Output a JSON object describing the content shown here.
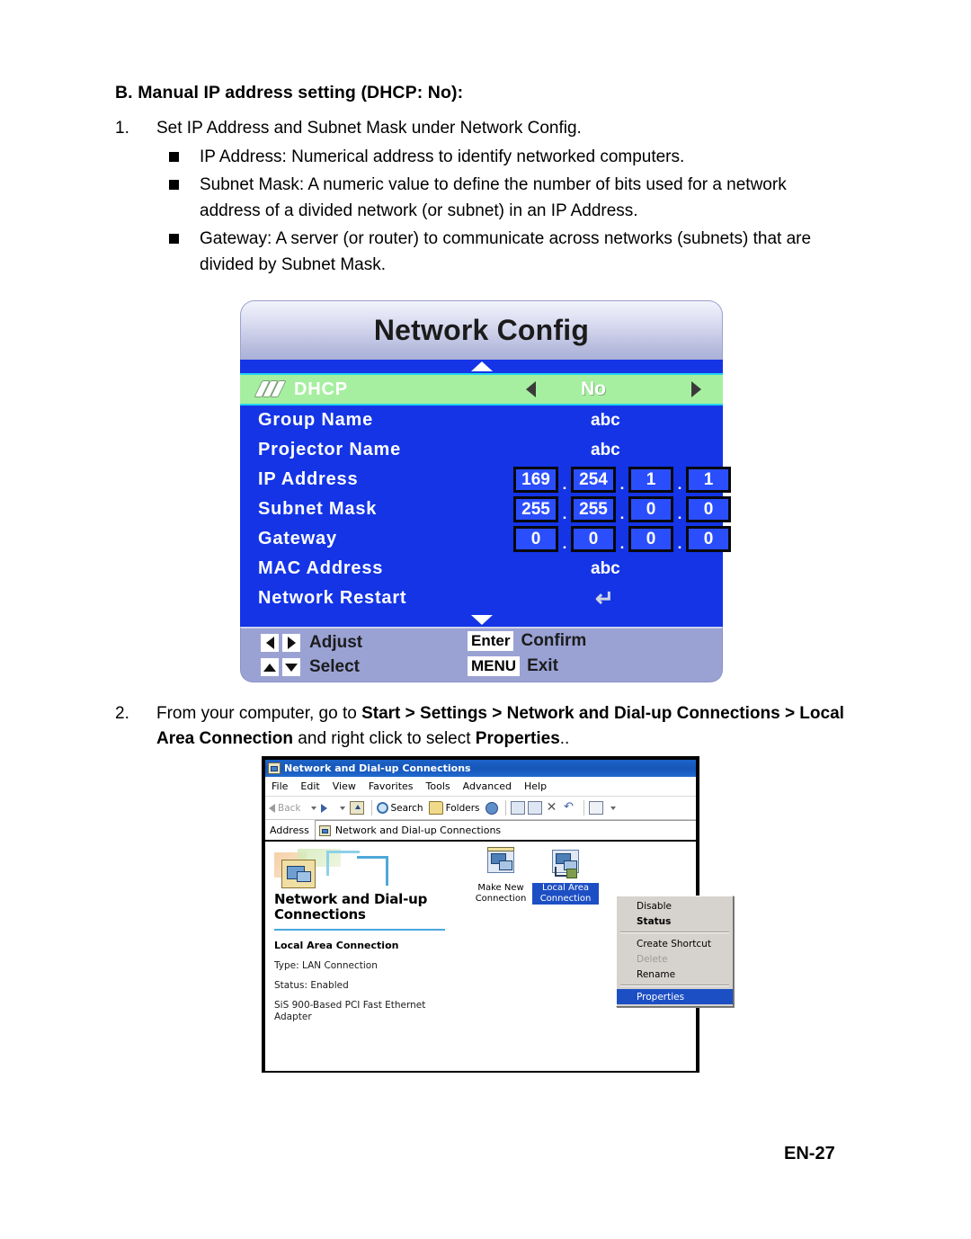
{
  "document": {
    "heading": "B. Manual IP address setting (DHCP: No):",
    "page_number": "EN-27",
    "step1": {
      "number": "1.",
      "text": "Set IP Address and Subnet Mask under Network Config.",
      "bullets": [
        "IP Address: Numerical address to identify networked computers.",
        "Subnet Mask: A numeric value to define the number of bits used for a network address of a divided network (or subnet) in an IP Address.",
        "Gateway: A server (or router) to communicate across networks (subnets) that are divided by Subnet Mask."
      ]
    },
    "step2": {
      "number": "2.",
      "part1": "From your computer, go to ",
      "bold1": "Start > Settings > Network and Dial-up Connections > Local Area Connection",
      "part2": " and right click to select ",
      "bold2": "Properties",
      "part3": ".."
    }
  },
  "osd": {
    "title": "Network Config",
    "scroll_up_icon": "triangle-up-icon",
    "scroll_down_icon": "triangle-down-icon",
    "rows": {
      "dhcp": {
        "label": "DHCP",
        "value": "No",
        "icon": "dhcp-chevrons-icon",
        "left_arrow": "left-arrow-icon",
        "right_arrow": "right-arrow-icon"
      },
      "group_name": {
        "label": "Group Name",
        "value": "abc"
      },
      "projector_name": {
        "label": "Projector Name",
        "value": "abc"
      },
      "ip_address": {
        "label": "IP Address",
        "octets": [
          "169",
          "254",
          "1",
          "1"
        ]
      },
      "subnet_mask": {
        "label": "Subnet Mask",
        "octets": [
          "255",
          "255",
          "0",
          "0"
        ]
      },
      "gateway": {
        "label": "Gateway",
        "octets": [
          "0",
          "0",
          "0",
          "0"
        ]
      },
      "mac_address": {
        "label": "MAC Address",
        "value": "abc"
      },
      "network_restart": {
        "label": "Network Restart",
        "value": "↵"
      }
    },
    "footer": {
      "adjust": "Adjust",
      "select": "Select",
      "enter_key": "Enter",
      "confirm": "Confirm",
      "menu_key": "MENU",
      "exit": "Exit"
    },
    "colors": {
      "body_blue": "#1434e6",
      "highlight_green": "#a6efa0",
      "highlight_border": "#23d3f0",
      "footer_lavender": "#9aa2d4"
    }
  },
  "explorer": {
    "title": "Network and Dial-up Connections",
    "title_icon": "network-connections-icon",
    "menu": [
      "File",
      "Edit",
      "View",
      "Favorites",
      "Tools",
      "Advanced",
      "Help"
    ],
    "toolbar": {
      "back": "Back",
      "search": "Search",
      "folders": "Folders",
      "icons": [
        "back-arrow-icon",
        "forward-arrow-icon",
        "up-folder-icon",
        "search-icon",
        "folders-icon",
        "history-globe-icon",
        "move-to-icon",
        "copy-to-icon",
        "delete-x-icon",
        "undo-icon",
        "views-icon"
      ]
    },
    "address": {
      "label": "Address",
      "value": "Network and Dial-up Connections",
      "icon": "network-connections-icon"
    },
    "left_panel": {
      "title": "Network and Dial-up Connections",
      "selected_item": "Local Area Connection",
      "type": "Type: LAN Connection",
      "status": "Status: Enabled",
      "adapter": "SiS 900-Based PCI Fast Ethernet Adapter"
    },
    "items": [
      {
        "label": "Make New Connection",
        "selected": false,
        "icon": "make-new-connection-icon"
      },
      {
        "label": "Local Area Connection",
        "selected": true,
        "icon": "local-area-connection-icon"
      }
    ],
    "context_menu": [
      {
        "label": "Disable",
        "style": "normal"
      },
      {
        "label": "Status",
        "style": "bold"
      },
      {
        "label": "--sep--",
        "style": "separator"
      },
      {
        "label": "Create Shortcut",
        "style": "normal"
      },
      {
        "label": "Delete",
        "style": "disabled"
      },
      {
        "label": "Rename",
        "style": "normal"
      },
      {
        "label": "--sep--",
        "style": "separator"
      },
      {
        "label": "Properties",
        "style": "selected"
      }
    ]
  }
}
